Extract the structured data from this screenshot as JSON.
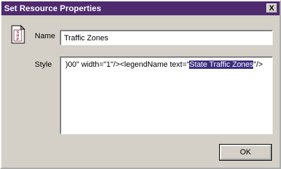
{
  "window": {
    "title": "Set Resource Properties",
    "close_label": "X"
  },
  "icon": {
    "name": "shp-file-icon",
    "text": "SHP"
  },
  "name_field": {
    "label": "Name",
    "value": "Traffic Zones"
  },
  "style_field": {
    "label": "Style",
    "text_before": ")00\" width=\"1\"/><legendName text=\"",
    "selected_text": "State Traffic Zones",
    "text_after": "\"/>"
  },
  "buttons": {
    "ok_label": "OK"
  }
}
